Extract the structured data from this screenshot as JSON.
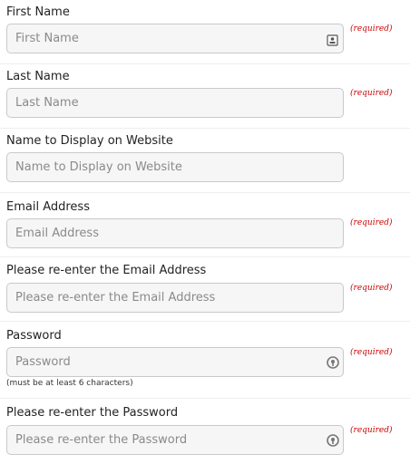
{
  "fields": [
    {
      "label": "First Name",
      "placeholder": "First Name",
      "required": "(required)",
      "icon": "contact-card-icon"
    },
    {
      "label": "Last Name",
      "placeholder": "Last Name",
      "required": "(required)"
    },
    {
      "label": "Name to Display on Website",
      "placeholder": "Name to Display on Website"
    },
    {
      "label": "Email Address",
      "placeholder": "Email Address",
      "required": "(required)"
    },
    {
      "label": "Please re-enter the Email Address",
      "placeholder": "Please re-enter the Email Address",
      "required": "(required)"
    },
    {
      "label": "Password",
      "placeholder": "Password",
      "required": "(required)",
      "hint": "(must be at least 6 characters)",
      "icon": "password-key-icon"
    },
    {
      "label": "Please re-enter the Password",
      "placeholder": "Please re-enter the Password",
      "required": "(required)",
      "icon": "password-key-icon"
    }
  ],
  "colors": {
    "required": "#cc0000",
    "input_bg": "#f6f6f6",
    "input_border": "#c9c9c9",
    "placeholder": "#8a8a8a"
  }
}
